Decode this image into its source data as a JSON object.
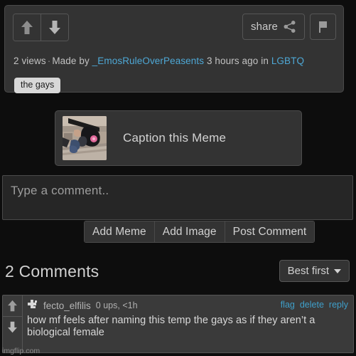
{
  "post": {
    "upvote_icon": "arrow-up-icon",
    "downvote_icon": "arrow-down-icon",
    "share_label": "share",
    "share_icon": "share-nodes-icon",
    "flag_icon": "flag-icon",
    "views": "2 views",
    "separator": "·",
    "made_by_label": "Made by",
    "author": "_EmosRuleOverPeasents",
    "time_ago": "3 hours ago",
    "in_label": "in",
    "stream": "LGBTQ",
    "tag": "the gays"
  },
  "caption_cta": {
    "label": "Caption this Meme",
    "thumbnail_alt": "meme-thumbnail"
  },
  "composer": {
    "placeholder": "Type a comment..",
    "value": "",
    "add_meme_label": "Add Meme",
    "add_image_label": "Add Image",
    "post_label": "Post Comment"
  },
  "comments_section": {
    "title": "2 Comments",
    "sort_label": "Best first",
    "sort_caret_icon": "chevron-down-icon"
  },
  "comments": [
    {
      "avatar_icon": "default-avatar-icon",
      "username": "fecto_elfilis",
      "ups": "0 ups, <1h",
      "flag_label": "flag",
      "delete_label": "delete",
      "reply_label": "reply",
      "body": "how mf feels after naming this temp the gays as if they aren’t a biological female",
      "upvote_icon": "arrow-up-icon",
      "downvote_icon": "arrow-down-icon"
    }
  ],
  "watermark": "imgflip.com",
  "colors": {
    "page_bg": "#0d0d0d",
    "card_bg": "#333333",
    "comment_bg": "#3a3a3a",
    "link": "#4ea8d6",
    "comment_link": "#3f9fc9",
    "tag_bg": "#d8d8d8",
    "text": "#cfcfcf"
  }
}
